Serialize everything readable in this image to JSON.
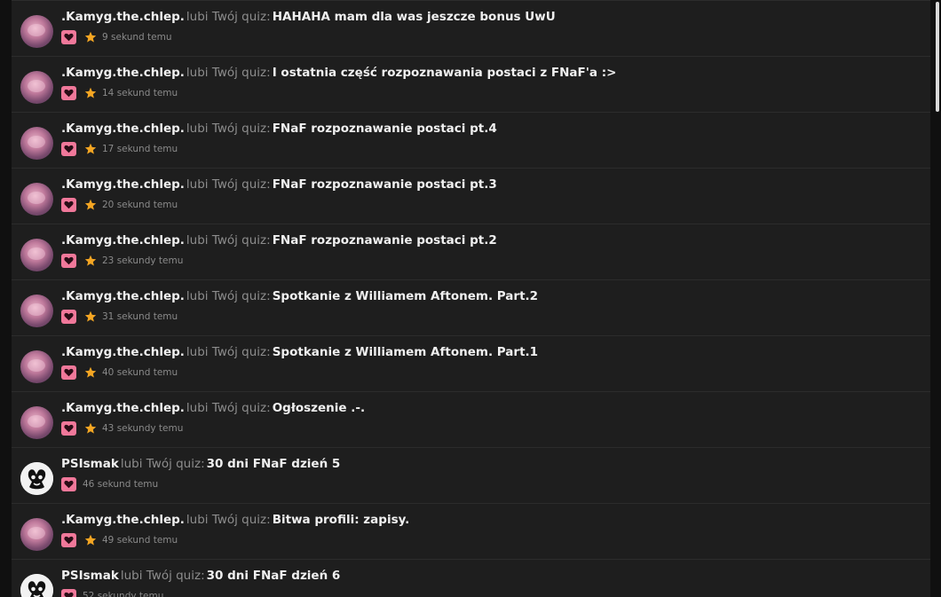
{
  "notifications": [
    {
      "user": ".Kamyg.the.chlep.",
      "verb": "lubi Twój quiz:",
      "title": "HAHAHA mam dla was jeszcze bonus UwU",
      "time": "9 sekund temu",
      "avatar": "pink",
      "starred": true
    },
    {
      "user": ".Kamyg.the.chlep.",
      "verb": "lubi Twój quiz:",
      "title": "I ostatnia część rozpoznawania postaci z FNaF'a :>",
      "time": "14 sekund temu",
      "avatar": "pink",
      "starred": true
    },
    {
      "user": ".Kamyg.the.chlep.",
      "verb": "lubi Twój quiz:",
      "title": "FNaF rozpoznawanie postaci pt.4",
      "time": "17 sekund temu",
      "avatar": "pink",
      "starred": true
    },
    {
      "user": ".Kamyg.the.chlep.",
      "verb": "lubi Twój quiz:",
      "title": "FNaF rozpoznawanie postaci pt.3",
      "time": "20 sekund temu",
      "avatar": "pink",
      "starred": true
    },
    {
      "user": ".Kamyg.the.chlep.",
      "verb": "lubi Twój quiz:",
      "title": "FNaF rozpoznawanie postaci pt.2",
      "time": "23 sekundy temu",
      "avatar": "pink",
      "starred": true
    },
    {
      "user": ".Kamyg.the.chlep.",
      "verb": "lubi Twój quiz:",
      "title": "Spotkanie z Williamem Aftonem. Part.2",
      "time": "31 sekund temu",
      "avatar": "pink",
      "starred": true
    },
    {
      "user": ".Kamyg.the.chlep.",
      "verb": "lubi Twój quiz:",
      "title": "Spotkanie z Williamem Aftonem. Part.1",
      "time": "40 sekund temu",
      "avatar": "pink",
      "starred": true
    },
    {
      "user": ".Kamyg.the.chlep.",
      "verb": "lubi Twój quiz:",
      "title": "Ogłoszenie .-.",
      "time": "43 sekundy temu",
      "avatar": "pink",
      "starred": true
    },
    {
      "user": "PSIsmak",
      "verb": "lubi Twój quiz:",
      "title": "30 dni FNaF dzień 5",
      "time": "46 sekund temu",
      "avatar": "bw",
      "starred": false
    },
    {
      "user": ".Kamyg.the.chlep.",
      "verb": "lubi Twój quiz:",
      "title": "Bitwa profili: zapisy.",
      "time": "49 sekund temu",
      "avatar": "pink",
      "starred": true
    },
    {
      "user": "PSIsmak",
      "verb": "lubi Twój quiz:",
      "title": "30 dni FNaF dzień 6",
      "time": "52 sekundy temu",
      "avatar": "bw",
      "starred": false
    }
  ],
  "icons": {
    "like": "heart-icon",
    "favorite": "star-icon"
  },
  "colors": {
    "background": "#1e1e1e",
    "heart_badge": "#f0789a",
    "star": "#f5a623",
    "username": "#f0f0f0",
    "muted_text": "#8d8d8d"
  }
}
